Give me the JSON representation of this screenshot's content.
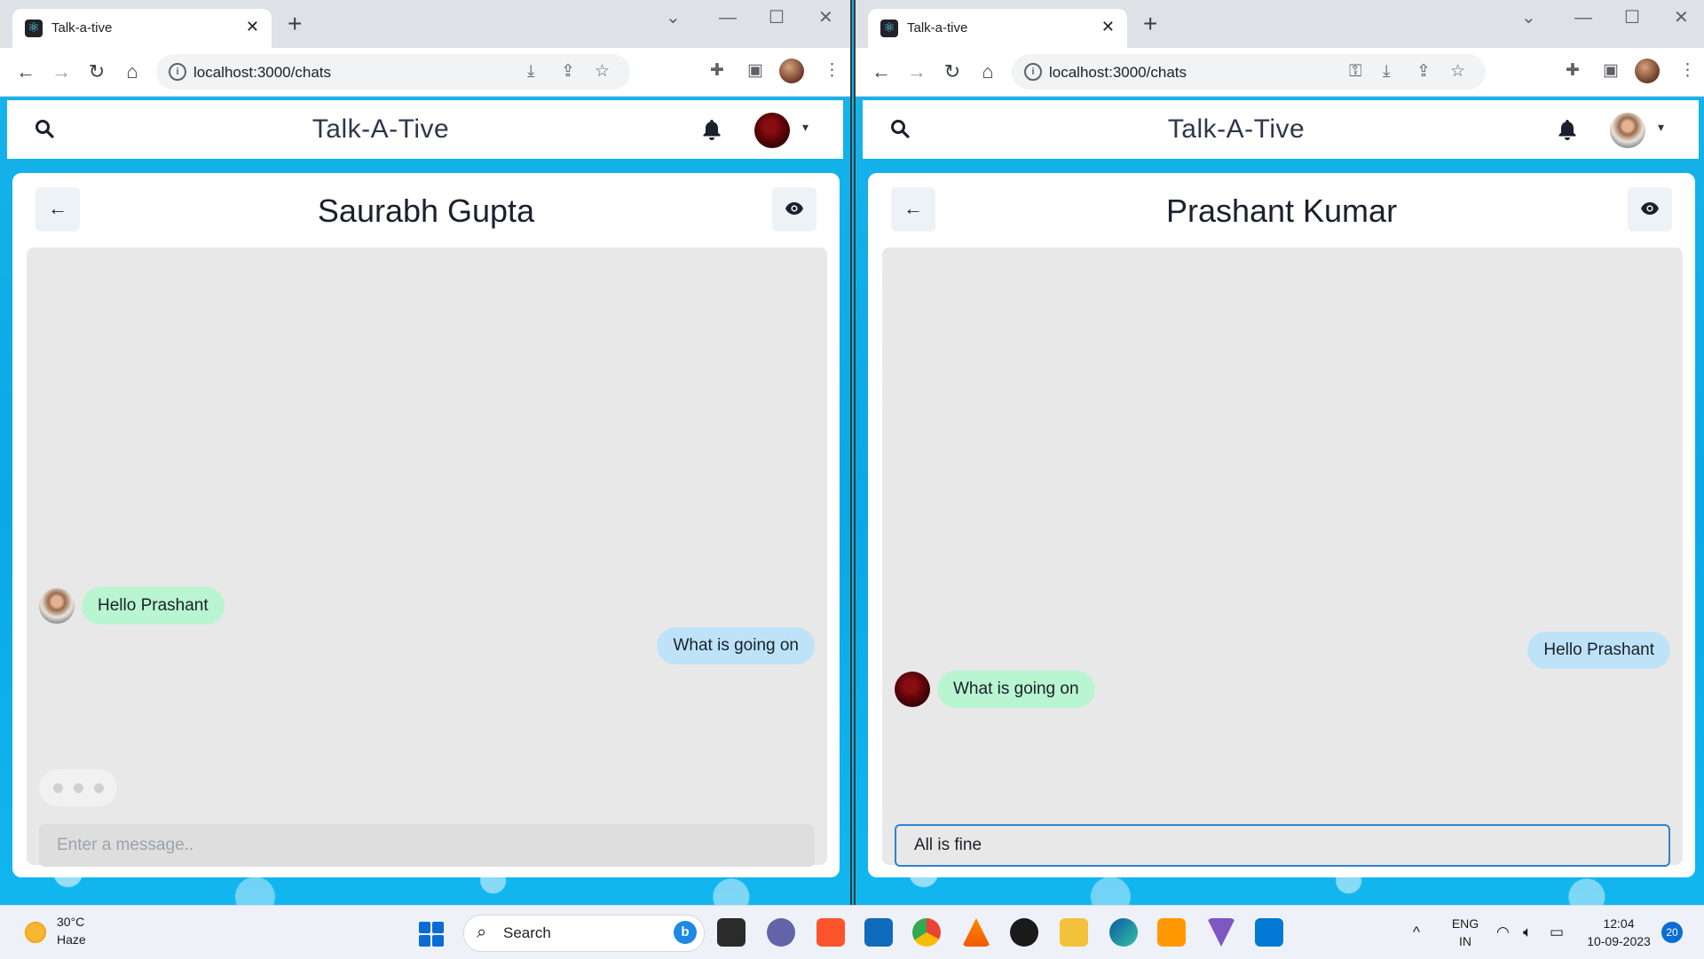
{
  "windows": [
    {
      "tab_title": "Talk-a-tive",
      "url": "localhost:3000/chats",
      "app_title": "Talk-A-Tive",
      "chat_title": "Saurabh Gupta",
      "messages": [
        {
          "text": "Hello Prashant",
          "side": "in"
        },
        {
          "text": "What is going on",
          "side": "out"
        }
      ],
      "typing_indicator": true,
      "input_placeholder": "Enter a message..",
      "input_value": ""
    },
    {
      "tab_title": "Talk-a-tive",
      "url": "localhost:3000/chats",
      "app_title": "Talk-A-Tive",
      "chat_title": "Prashant Kumar",
      "messages": [
        {
          "text": "Hello Prashant",
          "side": "out"
        },
        {
          "text": "What is going on",
          "side": "in"
        }
      ],
      "typing_indicator": false,
      "input_placeholder": "Enter a message..",
      "input_value": "All is fine"
    }
  ],
  "taskbar": {
    "weather_temp": "30°C",
    "weather_condition": "Haze",
    "search_label": "Search",
    "language": "ENG",
    "region": "IN",
    "time": "12:04",
    "date": "10-09-2023",
    "notification_count": "20"
  },
  "icons": {
    "back": "←",
    "forward": "→",
    "reload": "↻",
    "home": "⌂",
    "close": "✕",
    "new_tab": "+",
    "chevron": "⌄"
  },
  "colors": {
    "incoming_bubble": "#b9f5d0",
    "outgoing_bubble": "#bee3f8",
    "page_background": "#0ab4ee",
    "input_focus": "#3182ce"
  }
}
